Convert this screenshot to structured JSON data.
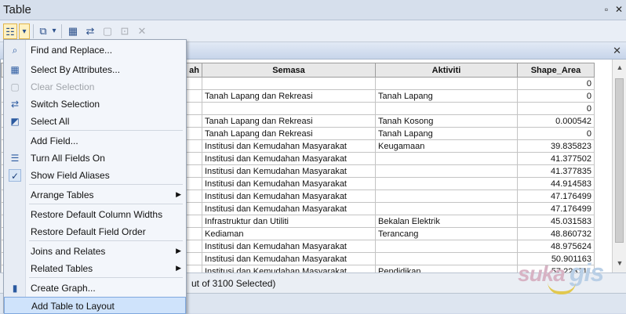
{
  "window": {
    "title": "Table",
    "pin_glyph": "▫",
    "close_glyph": "✕"
  },
  "toolbar": {
    "table_options_glyph": "☷",
    "dropdown_glyph": "▾",
    "related_tables_glyph": "⧉",
    "select_by_attr_glyph": "▦",
    "switch_sel_glyph": "⇄",
    "clear_sel_glyph": "▢",
    "zoom_sel_glyph": "⊡",
    "delete_glyph": "✕"
  },
  "tabstrip": {
    "close_glyph": "✕"
  },
  "table": {
    "columns": [
      "ah",
      "Semasa",
      "Aktiviti",
      "Shape_Area"
    ],
    "rows": [
      [
        "",
        "",
        "",
        "0"
      ],
      [
        "",
        "Tanah Lapang dan Rekreasi",
        "Tanah Lapang",
        "0"
      ],
      [
        "",
        "",
        "",
        "0"
      ],
      [
        "",
        "Tanah Lapang dan Rekreasi",
        "Tanah Kosong",
        "0.000542"
      ],
      [
        "",
        "Tanah Lapang dan Rekreasi",
        "Tanah Lapang",
        "0"
      ],
      [
        "",
        "Institusi dan Kemudahan Masyarakat",
        "Keugamaan",
        "39.835823"
      ],
      [
        "",
        "Institusi dan Kemudahan Masyarakat",
        "",
        "41.377502"
      ],
      [
        "",
        "Institusi dan Kemudahan Masyarakat",
        "",
        "41.377835"
      ],
      [
        "",
        "Institusi dan Kemudahan Masyarakat",
        "",
        "44.914583"
      ],
      [
        "",
        "Institusi dan Kemudahan Masyarakat",
        "",
        "47.176499"
      ],
      [
        "",
        "Institusi dan Kemudahan Masyarakat",
        "",
        "47.176499"
      ],
      [
        "",
        "Infrastruktur dan Utiliti",
        "Bekalan Elektrik",
        "45.031583"
      ],
      [
        "",
        "Kediaman",
        "Terancang",
        "48.860732"
      ],
      [
        "",
        "Institusi dan Kemudahan Masyarakat",
        "",
        "48.975624"
      ],
      [
        "",
        "Institusi dan Kemudahan Masyarakat",
        "",
        "50.901163"
      ],
      [
        "",
        "Institusi dan Kemudahan Masyarakat",
        "Pendidikan",
        "57.223711"
      ]
    ]
  },
  "scrollbar": {
    "up_glyph": "▲",
    "down_glyph": "▼"
  },
  "status": {
    "text": "ut of 3100 Selected)"
  },
  "menu": {
    "items": [
      {
        "label": "Find and Replace...",
        "icon": "binoculars-icon",
        "glyph": "⌕",
        "disabled": false
      },
      {
        "label": "Select By Attributes...",
        "icon": "select-by-attributes-icon",
        "glyph": "▦",
        "disabled": false
      },
      {
        "label": "Clear Selection",
        "icon": "clear-selection-icon",
        "glyph": "▢",
        "disabled": true
      },
      {
        "label": "Switch Selection",
        "icon": "switch-selection-icon",
        "glyph": "⇄",
        "disabled": false
      },
      {
        "label": "Select All",
        "icon": "select-all-icon",
        "glyph": "◩",
        "disabled": false
      },
      {
        "label": "Add Field...",
        "icon": "",
        "glyph": "",
        "disabled": false
      },
      {
        "label": "Turn All Fields On",
        "icon": "fields-list-icon",
        "glyph": "☰",
        "disabled": false
      },
      {
        "label": "Show Field Aliases",
        "icon": "checkmark-icon",
        "glyph": "✓",
        "disabled": false,
        "checked": true
      },
      {
        "label": "Arrange Tables",
        "icon": "",
        "glyph": "",
        "disabled": false,
        "submenu": true
      },
      {
        "label": "Restore Default Column Widths",
        "icon": "",
        "glyph": "",
        "disabled": false
      },
      {
        "label": "Restore Default Field Order",
        "icon": "",
        "glyph": "",
        "disabled": false
      },
      {
        "label": "Joins and Relates",
        "icon": "",
        "glyph": "",
        "disabled": false,
        "submenu": true
      },
      {
        "label": "Related Tables",
        "icon": "",
        "glyph": "",
        "disabled": false,
        "submenu": true
      },
      {
        "label": "Create Graph...",
        "icon": "bar-chart-icon",
        "glyph": "▮",
        "disabled": false
      },
      {
        "label": "Add Table to Layout",
        "icon": "",
        "glyph": "",
        "disabled": false,
        "highlighted": true
      }
    ],
    "submenu_glyph": "▶"
  },
  "watermark": {
    "part1": "suka",
    "part2": "gis"
  }
}
